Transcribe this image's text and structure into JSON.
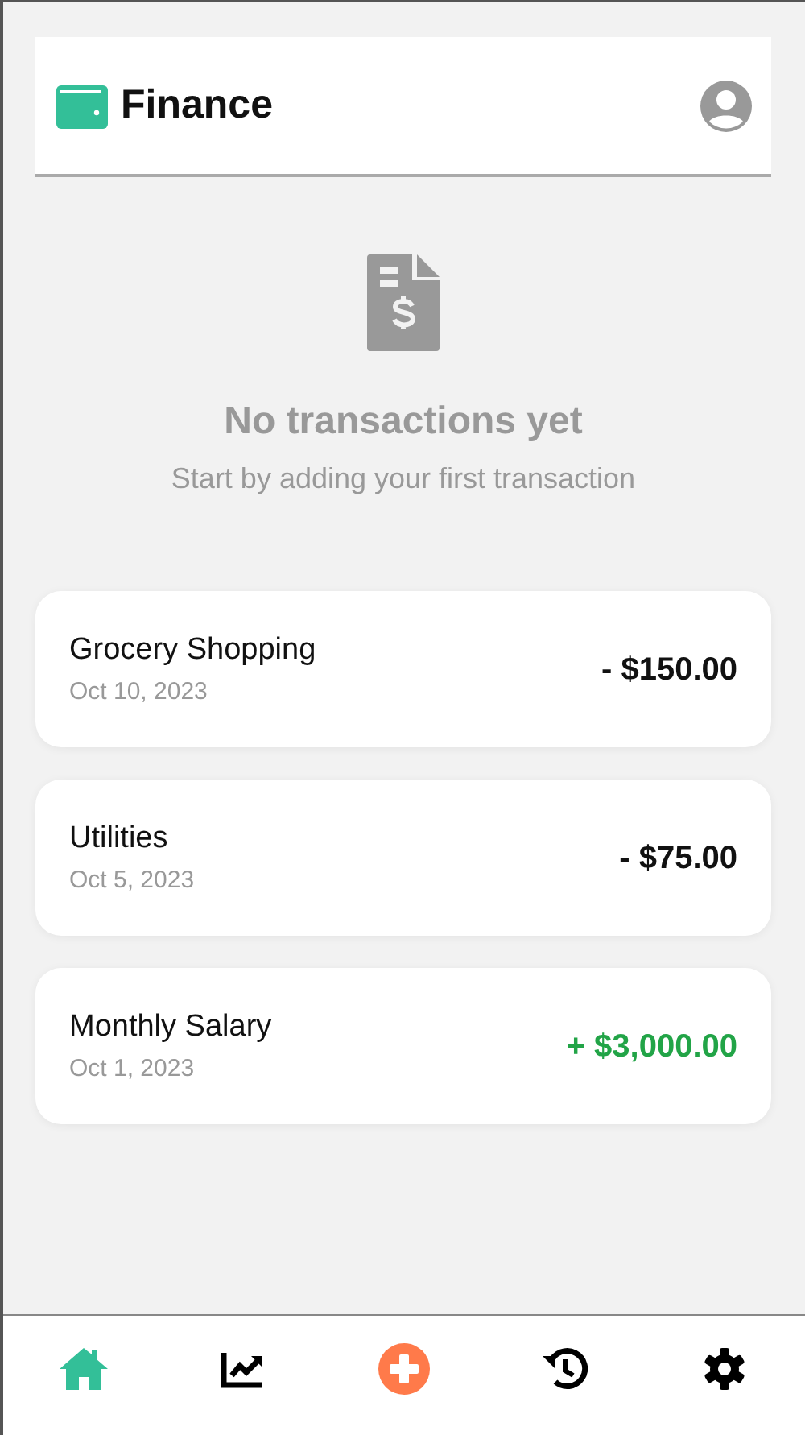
{
  "header": {
    "title": "Finance"
  },
  "empty_state": {
    "title": "No transactions yet",
    "subtitle": "Start by adding your first transaction"
  },
  "transactions": [
    {
      "name": "Grocery Shopping",
      "date": "Oct 10, 2023",
      "amount": "- $150.00",
      "kind": "expense"
    },
    {
      "name": "Utilities",
      "date": "Oct 5, 2023",
      "amount": "- $75.00",
      "kind": "expense"
    },
    {
      "name": "Monthly Salary",
      "date": "Oct 1, 2023",
      "amount": "+ $3,000.00",
      "kind": "income"
    }
  ],
  "bottom_nav": [
    {
      "kind": "home",
      "selected": true
    },
    {
      "kind": "chart",
      "selected": false
    },
    {
      "kind": "add",
      "selected": false
    },
    {
      "kind": "history",
      "selected": false
    },
    {
      "kind": "settings",
      "selected": false
    }
  ]
}
